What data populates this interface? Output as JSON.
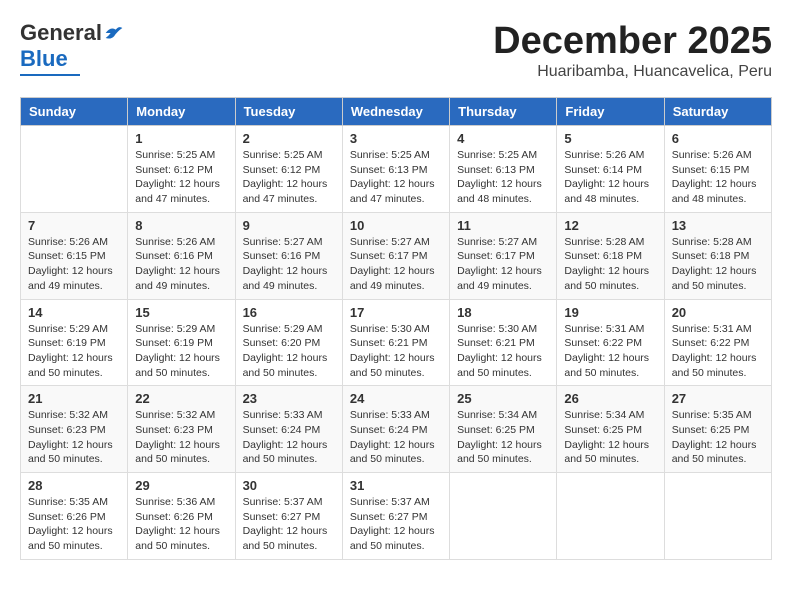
{
  "header": {
    "logo_general": "General",
    "logo_blue": "Blue",
    "month": "December 2025",
    "location": "Huaribamba, Huancavelica, Peru"
  },
  "days_of_week": [
    "Sunday",
    "Monday",
    "Tuesday",
    "Wednesday",
    "Thursday",
    "Friday",
    "Saturday"
  ],
  "weeks": [
    [
      {
        "day": "",
        "info": ""
      },
      {
        "day": "1",
        "info": "Sunrise: 5:25 AM\nSunset: 6:12 PM\nDaylight: 12 hours\nand 47 minutes."
      },
      {
        "day": "2",
        "info": "Sunrise: 5:25 AM\nSunset: 6:12 PM\nDaylight: 12 hours\nand 47 minutes."
      },
      {
        "day": "3",
        "info": "Sunrise: 5:25 AM\nSunset: 6:13 PM\nDaylight: 12 hours\nand 47 minutes."
      },
      {
        "day": "4",
        "info": "Sunrise: 5:25 AM\nSunset: 6:13 PM\nDaylight: 12 hours\nand 48 minutes."
      },
      {
        "day": "5",
        "info": "Sunrise: 5:26 AM\nSunset: 6:14 PM\nDaylight: 12 hours\nand 48 minutes."
      },
      {
        "day": "6",
        "info": "Sunrise: 5:26 AM\nSunset: 6:15 PM\nDaylight: 12 hours\nand 48 minutes."
      }
    ],
    [
      {
        "day": "7",
        "info": "Sunrise: 5:26 AM\nSunset: 6:15 PM\nDaylight: 12 hours\nand 49 minutes."
      },
      {
        "day": "8",
        "info": "Sunrise: 5:26 AM\nSunset: 6:16 PM\nDaylight: 12 hours\nand 49 minutes."
      },
      {
        "day": "9",
        "info": "Sunrise: 5:27 AM\nSunset: 6:16 PM\nDaylight: 12 hours\nand 49 minutes."
      },
      {
        "day": "10",
        "info": "Sunrise: 5:27 AM\nSunset: 6:17 PM\nDaylight: 12 hours\nand 49 minutes."
      },
      {
        "day": "11",
        "info": "Sunrise: 5:27 AM\nSunset: 6:17 PM\nDaylight: 12 hours\nand 49 minutes."
      },
      {
        "day": "12",
        "info": "Sunrise: 5:28 AM\nSunset: 6:18 PM\nDaylight: 12 hours\nand 50 minutes."
      },
      {
        "day": "13",
        "info": "Sunrise: 5:28 AM\nSunset: 6:18 PM\nDaylight: 12 hours\nand 50 minutes."
      }
    ],
    [
      {
        "day": "14",
        "info": "Sunrise: 5:29 AM\nSunset: 6:19 PM\nDaylight: 12 hours\nand 50 minutes."
      },
      {
        "day": "15",
        "info": "Sunrise: 5:29 AM\nSunset: 6:19 PM\nDaylight: 12 hours\nand 50 minutes."
      },
      {
        "day": "16",
        "info": "Sunrise: 5:29 AM\nSunset: 6:20 PM\nDaylight: 12 hours\nand 50 minutes."
      },
      {
        "day": "17",
        "info": "Sunrise: 5:30 AM\nSunset: 6:21 PM\nDaylight: 12 hours\nand 50 minutes."
      },
      {
        "day": "18",
        "info": "Sunrise: 5:30 AM\nSunset: 6:21 PM\nDaylight: 12 hours\nand 50 minutes."
      },
      {
        "day": "19",
        "info": "Sunrise: 5:31 AM\nSunset: 6:22 PM\nDaylight: 12 hours\nand 50 minutes."
      },
      {
        "day": "20",
        "info": "Sunrise: 5:31 AM\nSunset: 6:22 PM\nDaylight: 12 hours\nand 50 minutes."
      }
    ],
    [
      {
        "day": "21",
        "info": "Sunrise: 5:32 AM\nSunset: 6:23 PM\nDaylight: 12 hours\nand 50 minutes."
      },
      {
        "day": "22",
        "info": "Sunrise: 5:32 AM\nSunset: 6:23 PM\nDaylight: 12 hours\nand 50 minutes."
      },
      {
        "day": "23",
        "info": "Sunrise: 5:33 AM\nSunset: 6:24 PM\nDaylight: 12 hours\nand 50 minutes."
      },
      {
        "day": "24",
        "info": "Sunrise: 5:33 AM\nSunset: 6:24 PM\nDaylight: 12 hours\nand 50 minutes."
      },
      {
        "day": "25",
        "info": "Sunrise: 5:34 AM\nSunset: 6:25 PM\nDaylight: 12 hours\nand 50 minutes."
      },
      {
        "day": "26",
        "info": "Sunrise: 5:34 AM\nSunset: 6:25 PM\nDaylight: 12 hours\nand 50 minutes."
      },
      {
        "day": "27",
        "info": "Sunrise: 5:35 AM\nSunset: 6:25 PM\nDaylight: 12 hours\nand 50 minutes."
      }
    ],
    [
      {
        "day": "28",
        "info": "Sunrise: 5:35 AM\nSunset: 6:26 PM\nDaylight: 12 hours\nand 50 minutes."
      },
      {
        "day": "29",
        "info": "Sunrise: 5:36 AM\nSunset: 6:26 PM\nDaylight: 12 hours\nand 50 minutes."
      },
      {
        "day": "30",
        "info": "Sunrise: 5:37 AM\nSunset: 6:27 PM\nDaylight: 12 hours\nand 50 minutes."
      },
      {
        "day": "31",
        "info": "Sunrise: 5:37 AM\nSunset: 6:27 PM\nDaylight: 12 hours\nand 50 minutes."
      },
      {
        "day": "",
        "info": ""
      },
      {
        "day": "",
        "info": ""
      },
      {
        "day": "",
        "info": ""
      }
    ]
  ]
}
